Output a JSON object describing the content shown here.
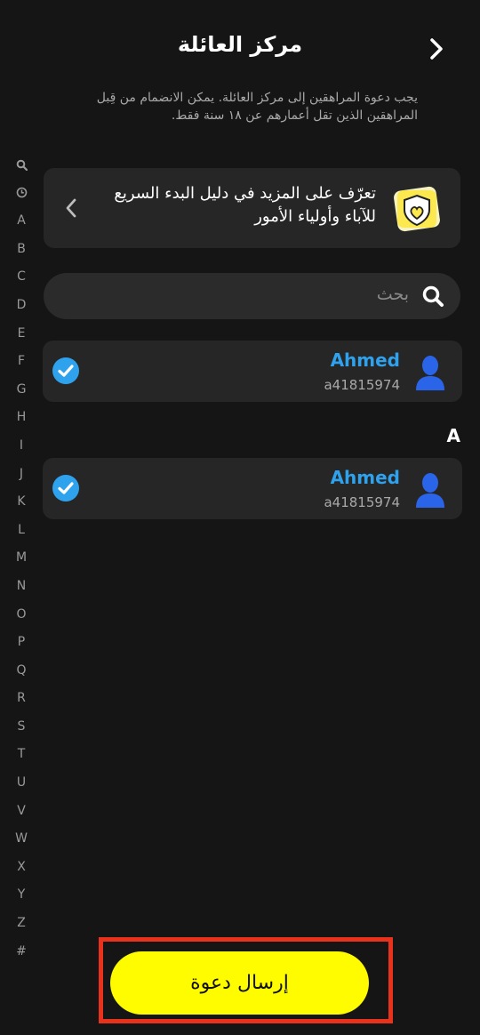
{
  "status_bar": {
    "clock": ""
  },
  "header": {
    "title": "مركز العائلة"
  },
  "notice": "يجب دعوة المراهقين إلى مركز العائلة. يمكن الانضمام من قِبل المراهقين الذين تقل أعمارهم عن ١٨ سنة فقط.",
  "guide_card": {
    "text": "تعرّف على المزيد في دليل البدء السريع للآباء وأولياء الأمور"
  },
  "search": {
    "placeholder": "بحث"
  },
  "alpha_index": [
    "search",
    "recent",
    "A",
    "B",
    "C",
    "D",
    "E",
    "F",
    "G",
    "H",
    "I",
    "J",
    "K",
    "L",
    "M",
    "N",
    "O",
    "P",
    "Q",
    "R",
    "S",
    "T",
    "U",
    "V",
    "W",
    "X",
    "Y",
    "Z",
    "#"
  ],
  "contacts": [
    {
      "name": "Ahmed",
      "handle": "a41815974",
      "selected": true
    },
    {
      "name": "Ahmed",
      "handle": "a41815974",
      "selected": true
    }
  ],
  "section_header": "A",
  "send_button": {
    "label": "إرسال دعوة"
  },
  "colors": {
    "background": "#151515",
    "card": "#262626",
    "accent_blue": "#2fa2ee",
    "button_yellow": "#fffc00",
    "highlight_red": "#e8321b"
  }
}
